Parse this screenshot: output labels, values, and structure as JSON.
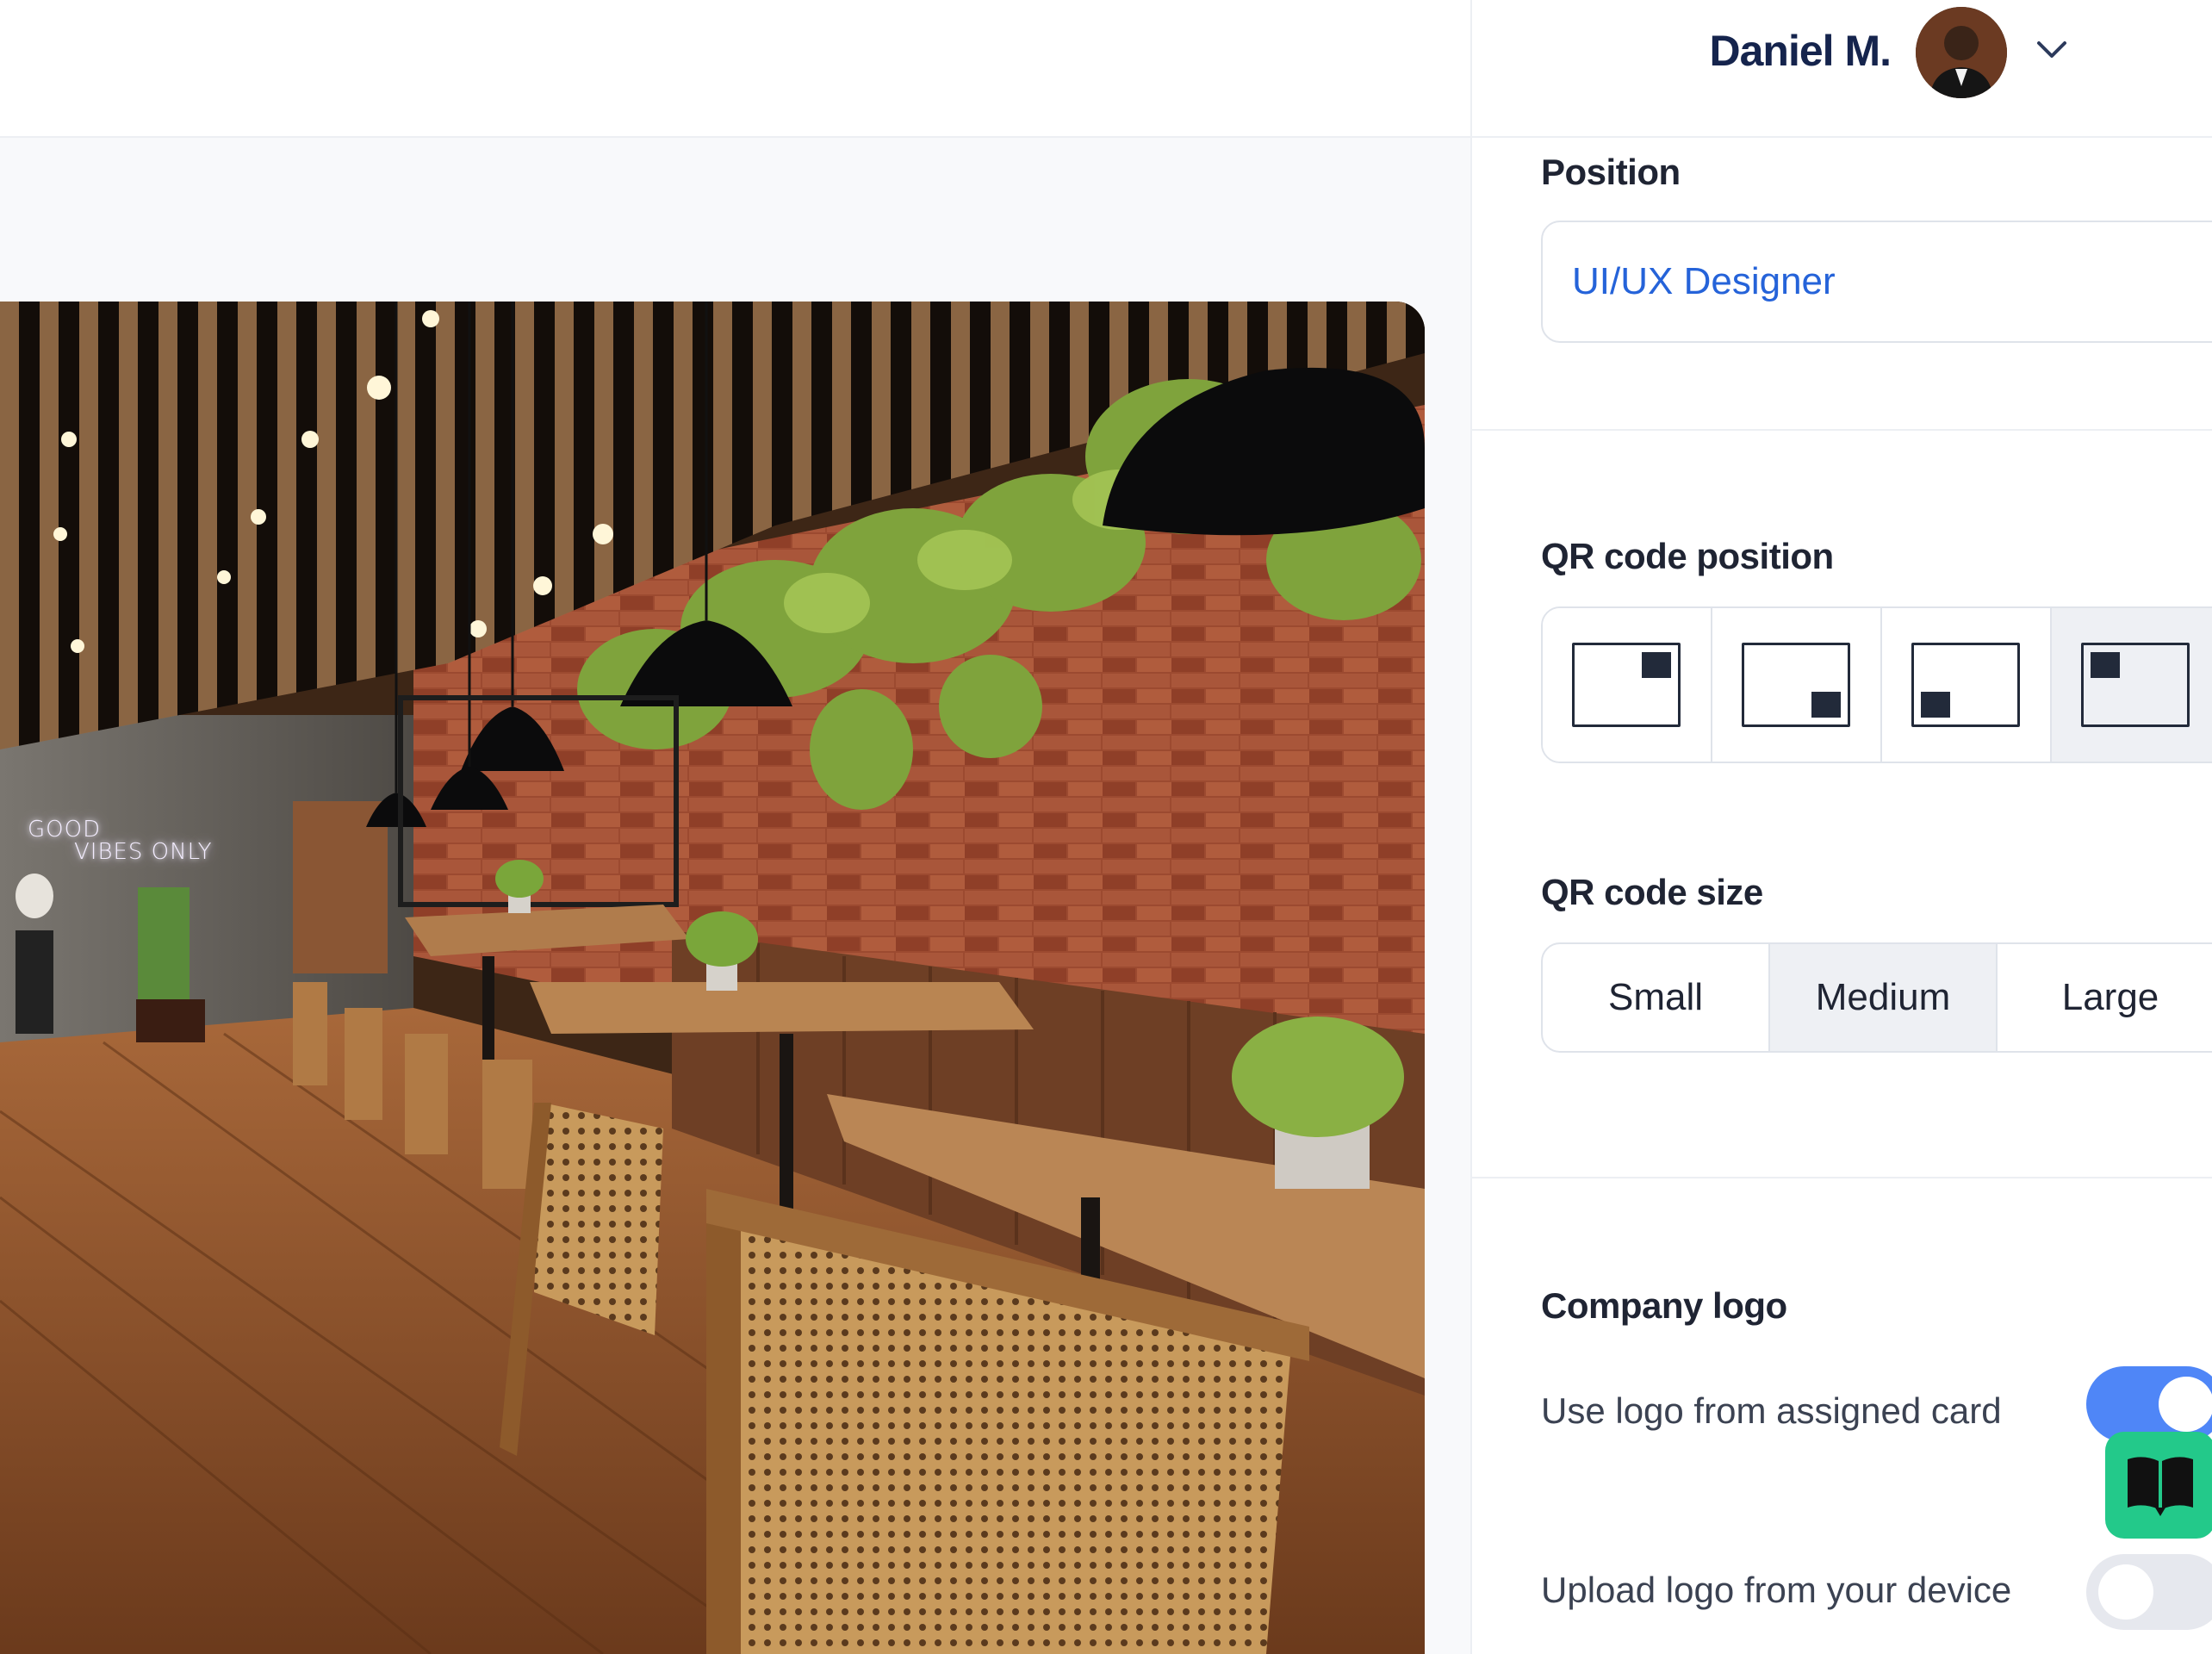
{
  "header": {
    "user_name": "Daniel M.",
    "avatar_icon": "user-avatar",
    "menu_icon": "chevron-down-icon"
  },
  "photo": {
    "neon_line1": "GOOD",
    "neon_line2": "VIBES ONLY"
  },
  "settings": {
    "position": {
      "label": "Position",
      "value": "UI/UX Designer"
    },
    "qr_position": {
      "label": "QR code position",
      "options": [
        "top-right",
        "bottom-right",
        "bottom-left",
        "top-left"
      ],
      "selected": "top-left"
    },
    "qr_size": {
      "label": "QR code size",
      "options": [
        "Small",
        "Medium",
        "Large"
      ],
      "selected": "Medium"
    },
    "company_logo": {
      "label": "Company logo",
      "use_assigned": {
        "label": "Use logo from assigned card",
        "on": true
      },
      "upload": {
        "label": "Upload logo from your device",
        "on": false
      },
      "logo_icon": "open-book-icon",
      "logo_color": "#23c98a"
    }
  },
  "colors": {
    "accent": "#4f86f7",
    "link": "#2563d9",
    "name": "#15244d"
  }
}
